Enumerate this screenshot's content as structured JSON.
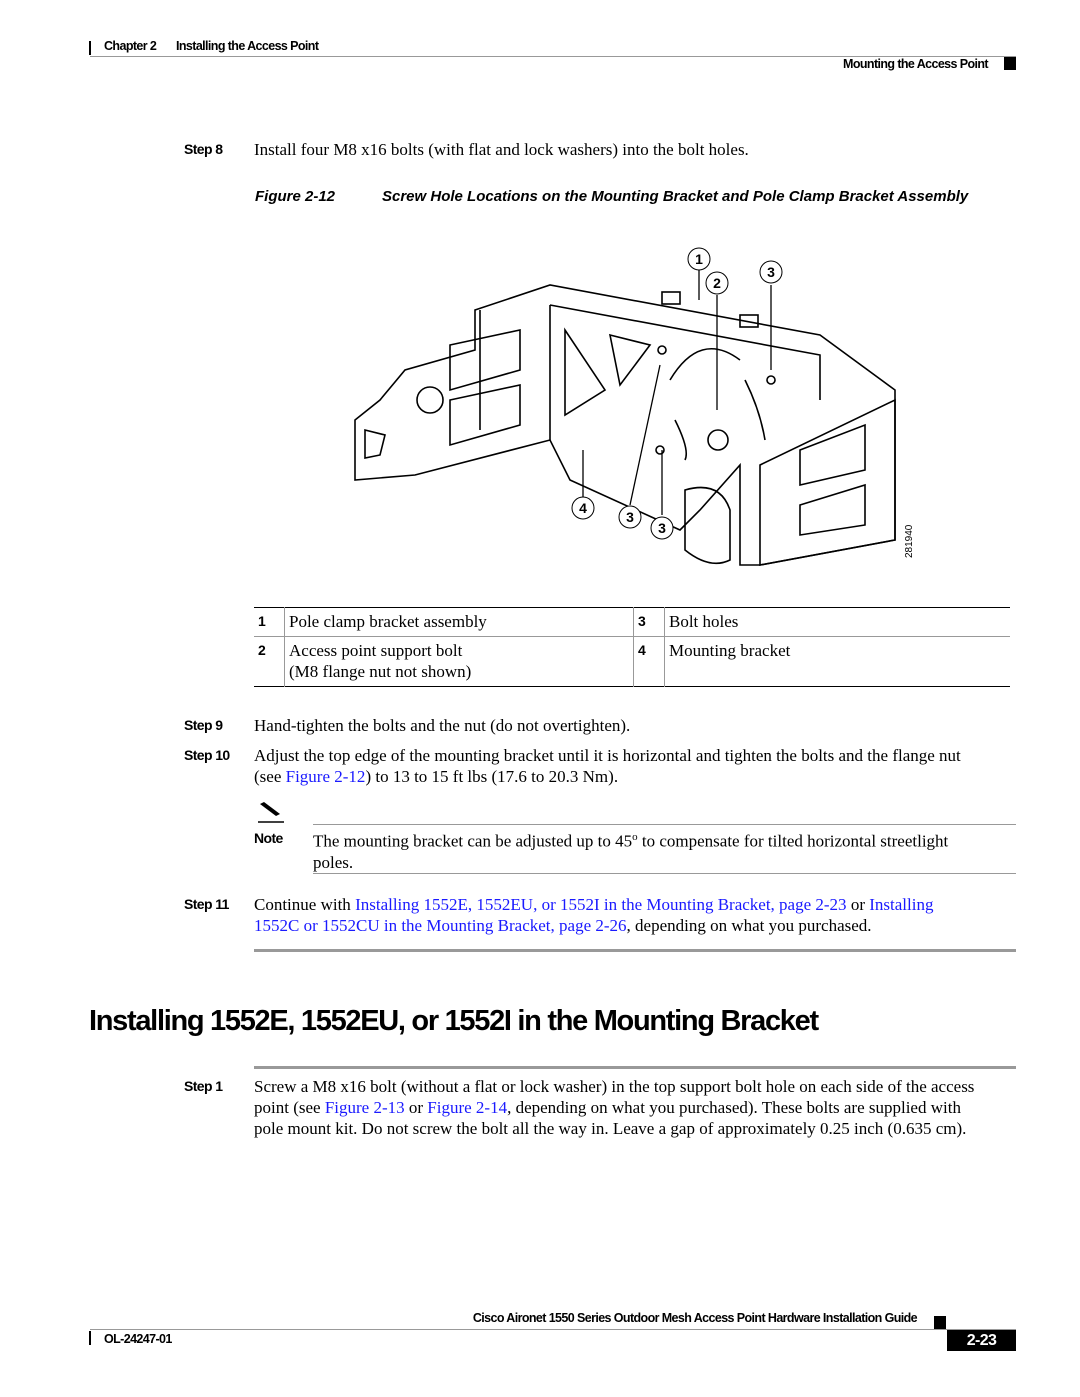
{
  "header": {
    "chapter": "Chapter 2",
    "chapter_title": "Installing the Access Point",
    "section": "Mounting the Access Point"
  },
  "step8": {
    "label": "Step 8",
    "text": "Install four M8 x16 bolts (with flat and lock washers) into the bolt holes."
  },
  "figure": {
    "number": "Figure 2-12",
    "title": "Screw Hole Locations on the Mounting Bracket and Pole Clamp Bracket Assembly",
    "art_id": "281940",
    "callouts": [
      "1",
      "2",
      "3",
      "3",
      "3",
      "4"
    ]
  },
  "legend": [
    {
      "num": "1",
      "text": "Pole clamp bracket assembly",
      "num2": "3",
      "text2": "Bolt holes"
    },
    {
      "num": "2",
      "text": "Access point support bolt",
      "text_b": "(M8 flange nut not shown)",
      "num2": "4",
      "text2": "Mounting bracket"
    }
  ],
  "step9": {
    "label": "Step 9",
    "text": "Hand-tighten the bolts and the nut (do not overtighten)."
  },
  "step10": {
    "label": "Step 10",
    "text_a": "Adjust the top edge of the mounting bracket until it is horizontal and tighten the bolts and the flange nut",
    "text_b": "(see ",
    "link1": "Figure",
    "link2": "2-12",
    "text_c": ") to 13 to 15 ft lbs (17.6 to 20.3 Nm)."
  },
  "note": {
    "label": "Note",
    "text_a": "The mounting bracket can be adjusted up to 45",
    "sup": "o",
    "text_b": " to compensate for tilted horizontal streetlight",
    "text_c": "poles."
  },
  "step11": {
    "label": "Step 11",
    "text_a": "Continue with ",
    "link1": "Installing 1552E, 1552EU, or 1552I in the Mounting Bracket, page 2-23",
    "text_b": " or ",
    "link2a": "Installing",
    "link2b": "1552C or 1552CU in the Mounting Bracket, page 2-26",
    "text_c": ", depending on what you purchased."
  },
  "section_heading": "Installing 1552E, 1552EU, or 1552I in the Mounting Bracket",
  "s1": {
    "label": "Step 1",
    "line1": "Screw a M8 x16 bolt (without a flat or lock washer) in the top support bolt hole on each side of the access",
    "l2a": "point (see ",
    "l2link1": "Figure 2-13",
    "l2b": " or ",
    "l2link2": "Figure 2-14",
    "l2c": ", depending on what you purchased). These bolts are supplied with",
    "line3": "pole mount kit. Do not screw the bolt all the way in. Leave a gap of approximately 0.25 inch (0.635 cm)."
  },
  "footer": {
    "guide_title": "Cisco Aironet 1550 Series Outdoor Mesh Access Point Hardware Installation Guide",
    "doc_id": "OL-24247-01",
    "page": "2-23"
  },
  "colors": {
    "link": "#1a1aff",
    "rule": "#999999"
  }
}
